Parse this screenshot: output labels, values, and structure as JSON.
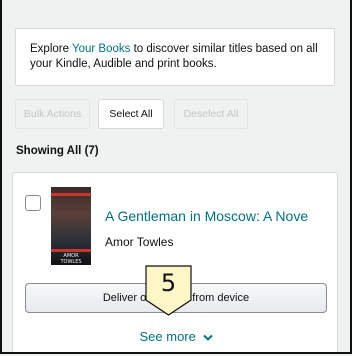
{
  "info": {
    "prefix": "Explore ",
    "link": "Your Books",
    "suffix": " to discover similar titles based on all your Kindle, Audible and print books."
  },
  "toolbar": {
    "bulk_actions": "Bulk Actions",
    "select_all": "Select All",
    "deselect_all": "Deselect All"
  },
  "showing": "Showing All (7)",
  "book": {
    "title": "A Gentleman in Moscow: A Nove",
    "author": "Amor Towles",
    "cover_author": "AMOR TOWLES",
    "action_left": "Deliver o",
    "action_right": "from device",
    "see_more": "See more"
  },
  "overlay": {
    "step": "5"
  },
  "colors": {
    "link": "#007185",
    "badge": "#fff6c8"
  }
}
